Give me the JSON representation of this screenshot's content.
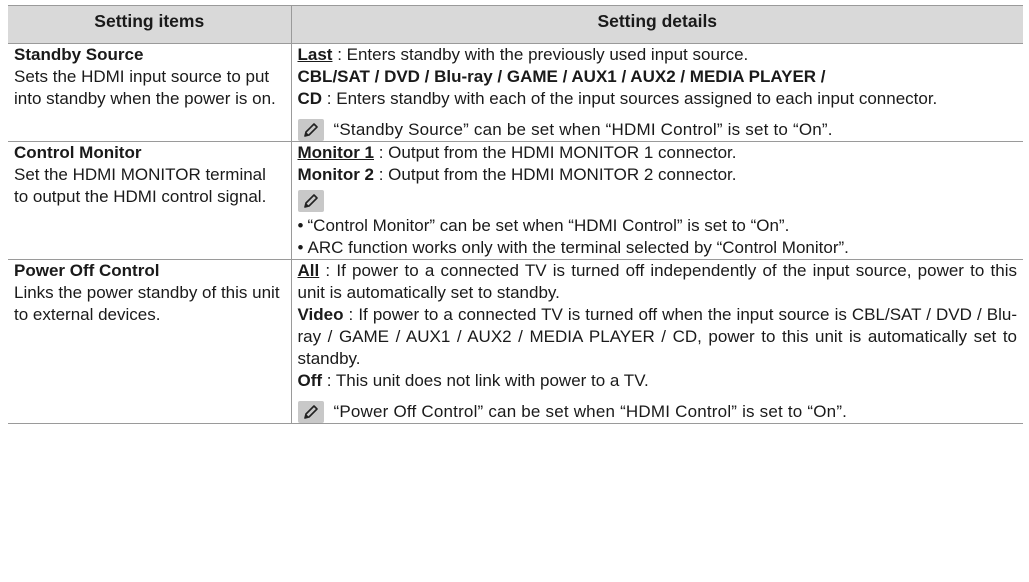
{
  "table": {
    "headers": {
      "items": "Setting items",
      "details": "Setting details"
    },
    "rows": [
      {
        "title": "Standby Source",
        "desc": "Sets the HDMI input source to put into standby when the power is on.",
        "options": [
          {
            "label": "Last",
            "text": " : Enters standby with the previously used input source."
          }
        ],
        "sources_line": "CBL/SAT / DVD / Blu-ray / GAME / AUX1 / AUX2 / MEDIA PLAYER /",
        "sources_line2_bold": "CD",
        "sources_line2_text": " : Enters standby with each of the input sources assigned to each input connector.",
        "note": "“Standby Source” can be set when “HDMI Control” is set to “On”."
      },
      {
        "title": "Control Monitor",
        "desc": "Set the HDMI MONITOR terminal to output the HDMI control signal.",
        "options": [
          {
            "label": "Monitor 1",
            "text": " : Output from the HDMI MONITOR 1 connector."
          },
          {
            "label": "Monitor 2",
            "text": " : Output from the HDMI MONITOR 2 connector."
          }
        ],
        "bullets": [
          "“Control Monitor” can be set when “HDMI Control” is set to “On”.",
          "ARC function works only with the terminal selected by “Control Monitor”."
        ]
      },
      {
        "title": "Power Off Control",
        "desc": "Links the power standby of this unit to external devices.",
        "options": [
          {
            "label": "All",
            "text": " : If power to a connected TV is turned off independently of the input source, power to this unit is automatically set to standby."
          },
          {
            "label": "Video",
            "text": " : If power to a connected TV is turned off when the input source is CBL/SAT / DVD / Blu-ray / GAME / AUX1 / AUX2 / MEDIA PLAYER / CD, power to this unit is automatically set to standby."
          },
          {
            "label": "Off",
            "text": " : This unit does not link with power to a TV."
          }
        ],
        "note": "“Power Off Control” can be set when “HDMI Control” is set to “On”."
      }
    ]
  },
  "icons": {
    "note": "pencil-icon"
  },
  "colors": {
    "header_bg": "#d9d9d9",
    "rule": "#9a9a9a",
    "text": "#1a1a1a"
  }
}
